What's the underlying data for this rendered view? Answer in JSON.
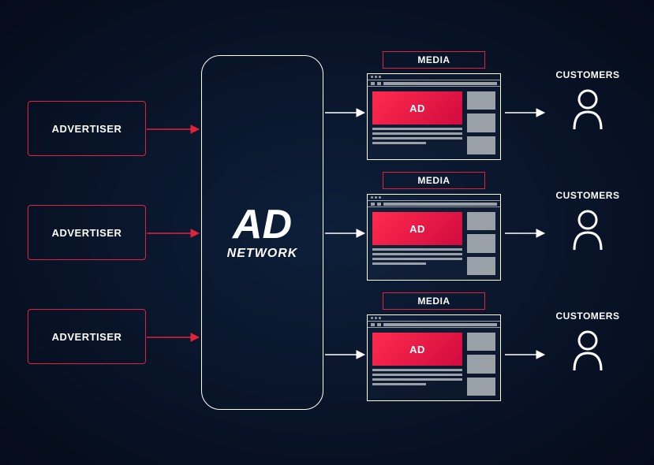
{
  "advertisers": [
    {
      "label": "ADVERTISER"
    },
    {
      "label": "ADVERTISER"
    },
    {
      "label": "ADVERTISER"
    }
  ],
  "center": {
    "title": "AD",
    "subtitle": "NETWORK"
  },
  "media": [
    {
      "label": "MEDIA",
      "ad_text": "AD"
    },
    {
      "label": "MEDIA",
      "ad_text": "AD"
    },
    {
      "label": "MEDIA",
      "ad_text": "AD"
    }
  ],
  "customers": [
    {
      "label": "CUSTOMERS"
    },
    {
      "label": "CUSTOMERS"
    },
    {
      "label": "CUSTOMERS"
    }
  ]
}
